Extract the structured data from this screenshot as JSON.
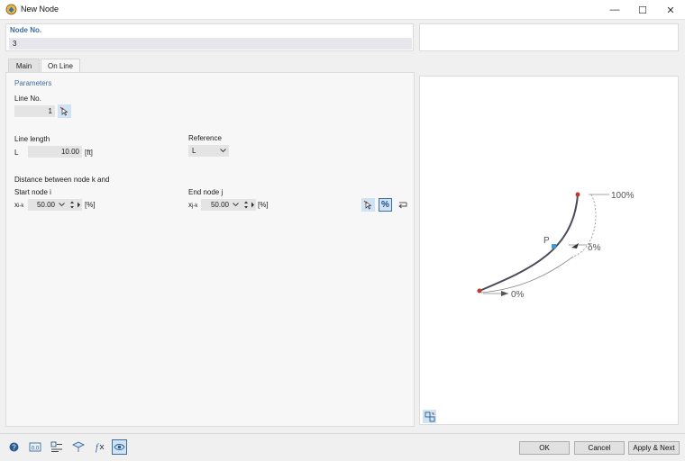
{
  "window": {
    "title": "New Node",
    "minimize_glyph": "—",
    "maximize_glyph": "☐",
    "close_glyph": "✕"
  },
  "node": {
    "label": "Node No.",
    "value": "3"
  },
  "tabs": [
    {
      "label": "Main",
      "active": false
    },
    {
      "label": "On Line",
      "active": true
    }
  ],
  "parameters": {
    "heading": "Parameters",
    "line_no_label": "Line No.",
    "line_no_value": "1",
    "line_length_label": "Line length",
    "line_length_symbol": "L",
    "line_length_value": "10.00",
    "line_length_unit": "[ft]",
    "reference_label": "Reference",
    "reference_value": "L",
    "distance_label": "Distance between node k and",
    "start_node_label": "Start node i",
    "start_symbol_main": "x",
    "start_symbol_sub": "i-k",
    "start_value": "50.00",
    "start_unit": "[%]",
    "end_node_label": "End node j",
    "end_symbol_main": "x",
    "end_symbol_sub": "j-k",
    "end_value": "50.00",
    "end_unit": "[%]",
    "percent_button_label": "%"
  },
  "diagram": {
    "label_p": "P",
    "label_100": "100%",
    "label_delta": "δ%",
    "label_0": "0%"
  },
  "buttons": {
    "ok": "OK",
    "cancel": "Cancel",
    "apply_next": "Apply & Next"
  },
  "colors": {
    "accent_blue": "#3e6e9c",
    "node_red": "#c0392b",
    "point_blue": "#3a9ad9",
    "curve": "#4a4a5a"
  }
}
